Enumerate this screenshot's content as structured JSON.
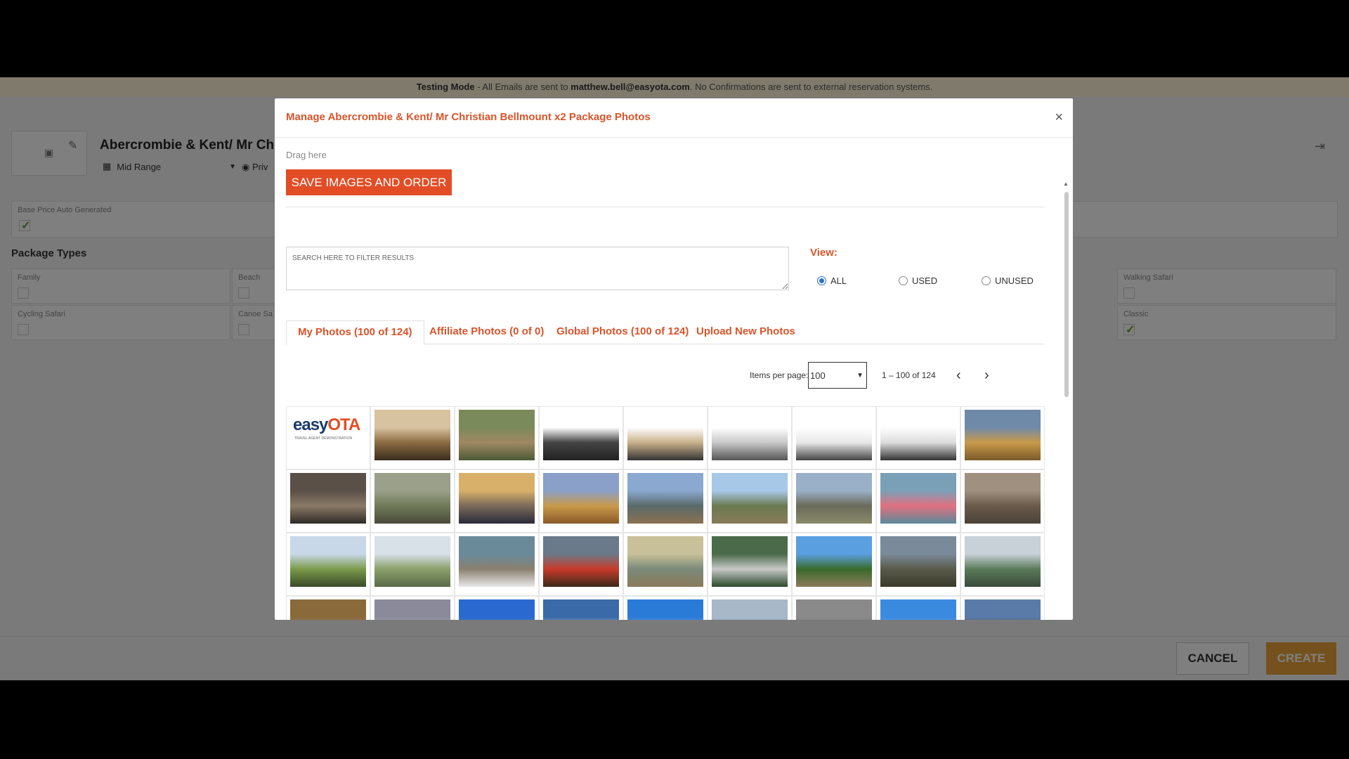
{
  "app": {
    "testing_bar": {
      "mode_label": "Testing Mode",
      "text_before_email": " - All Emails are sent to ",
      "email": "matthew.bell@easyota.com",
      "text_after_email": ". No Confirmations are sent to external reservation systems."
    },
    "package": {
      "title": "Abercrombie & Kent/ Mr Chr",
      "range_value": "Mid Range",
      "privacy_label": "Priv"
    },
    "base_price_label": "Base Price Auto Generated",
    "package_types_title": "Package Types",
    "package_types": [
      {
        "label": "Family",
        "checked": false
      },
      {
        "label": "Beach",
        "checked": false
      },
      {
        "label": "Walking Safari",
        "checked": false
      },
      {
        "label": "Cycling Safari",
        "checked": false
      },
      {
        "label": "Canoe Sa",
        "checked": false
      },
      {
        "label": "Classic",
        "checked": true
      }
    ],
    "footer": {
      "cancel_label": "CANCEL",
      "create_label": "CREATE"
    }
  },
  "modal": {
    "title": "Manage Abercrombie & Kent/ Mr Christian Bellmount x2 Package Photos",
    "close_glyph": "×",
    "drag_here": "Drag here",
    "save_label": "SAVE IMAGES AND ORDER",
    "search_placeholder": "SEARCH HERE TO FILTER RESULTS",
    "view_label": "View:",
    "view_options": [
      {
        "label": "ALL",
        "selected": true
      },
      {
        "label": "USED",
        "selected": false
      },
      {
        "label": "UNUSED",
        "selected": false
      }
    ],
    "tabs": [
      {
        "label": "My Photos (100 of 124)",
        "active": true
      },
      {
        "label": "Affiliate Photos (0 of 0)",
        "active": false
      },
      {
        "label": "Global Photos (100 of 124)",
        "active": false
      },
      {
        "label": "Upload New Photos",
        "active": false
      }
    ],
    "pager": {
      "items_per_page_label": "Items per page:",
      "items_per_page_value": "100",
      "range_label": "1 – 100 of 124"
    },
    "logo": {
      "main": "easy",
      "accent": "OTA",
      "sub": "TRAVEL AGENT DEMONSTRATION"
    },
    "photos": [
      {
        "name": "easyota-logo-photo",
        "kind": "logo"
      },
      {
        "name": "lodge-interior-photo",
        "colors": [
          "#d8c3a0",
          "#8a6a42",
          "#3b2d1e"
        ]
      },
      {
        "name": "giraffes-photo",
        "colors": [
          "#7a8a5a",
          "#a08863",
          "#4a5a36"
        ]
      },
      {
        "name": "safari-jeep-photo",
        "colors": [
          "#ffffff",
          "#444444",
          "#222222"
        ]
      },
      {
        "name": "safari-landcruiser-photo",
        "colors": [
          "#ffffff",
          "#c8b08a",
          "#333333"
        ]
      },
      {
        "name": "silver-van-photo",
        "colors": [
          "#ffffff",
          "#c8c8c8",
          "#555555"
        ]
      },
      {
        "name": "white-minibus-photo",
        "colors": [
          "#ffffff",
          "#e8e8e8",
          "#444444"
        ]
      },
      {
        "name": "white-bus-photo",
        "colors": [
          "#ffffff",
          "#dcdcdc",
          "#333333"
        ]
      },
      {
        "name": "savanna-sunset-photo",
        "colors": [
          "#6f8aa8",
          "#c99a4a",
          "#7a5a2a"
        ]
      },
      {
        "name": "jeep-dust-photo",
        "colors": [
          "#5a5048",
          "#8a7a66",
          "#2e2a26"
        ]
      },
      {
        "name": "jeep-zebras-photo",
        "colors": [
          "#9aa08a",
          "#6f7a58",
          "#4a4a3a"
        ]
      },
      {
        "name": "city-skyline-photo",
        "colors": [
          "#d8b06a",
          "#7a6a5a",
          "#2a2a3a"
        ]
      },
      {
        "name": "zebras-plains-photo",
        "colors": [
          "#8aa0c8",
          "#c89a4a",
          "#8a5a2a"
        ]
      },
      {
        "name": "crater-view-photo",
        "colors": [
          "#8aa8d0",
          "#5a6a6a",
          "#8a7050"
        ]
      },
      {
        "name": "leopard-tree-photo",
        "colors": [
          "#a8c8e8",
          "#6a7a50",
          "#8a7a5a"
        ]
      },
      {
        "name": "wildebeest-photo",
        "colors": [
          "#9ab0c8",
          "#6a6a5a",
          "#8a8a6a"
        ]
      },
      {
        "name": "flamingos-photo",
        "colors": [
          "#7aa0b8",
          "#e07080",
          "#5a8a9a"
        ]
      },
      {
        "name": "elephants-baobab-photo",
        "colors": [
          "#a09080",
          "#6a5a4a",
          "#4a4238"
        ]
      },
      {
        "name": "zebra-grass-photo",
        "colors": [
          "#c8d8e8",
          "#7a9a4a",
          "#3a4a2a"
        ]
      },
      {
        "name": "acacia-tree-photo",
        "colors": [
          "#d8e0e8",
          "#8aa06a",
          "#5a6a4a"
        ]
      },
      {
        "name": "rhino-birds-photo",
        "colors": [
          "#6a8a9a",
          "#8a8070",
          "#e8e8e8"
        ]
      },
      {
        "name": "maasai-warriors-photo",
        "colors": [
          "#6a7a8a",
          "#c83a2a",
          "#3a2a1a"
        ]
      },
      {
        "name": "waterhole-animals-photo",
        "colors": [
          "#c8c098",
          "#7a8a7a",
          "#8a7a5a"
        ]
      },
      {
        "name": "hotel-aerial-photo",
        "colors": [
          "#4a6a4a",
          "#c8c8c8",
          "#2a4a2a"
        ]
      },
      {
        "name": "elephant-acacia-photo",
        "colors": [
          "#5aa0e0",
          "#3a6a2a",
          "#8a7a5a"
        ]
      },
      {
        "name": "baobab-road-photo",
        "colors": [
          "#7a8a9a",
          "#5a5a4a",
          "#3a3a2a"
        ]
      },
      {
        "name": "coastline-aerial-photo",
        "colors": [
          "#c8d0d8",
          "#5a7a5a",
          "#3a4a3a"
        ]
      },
      {
        "name": "lion-closeup-photo",
        "colors": [
          "#8a6a3a",
          "#b08a5a",
          "#5a3a1a"
        ]
      },
      {
        "name": "misty-hills-photo",
        "colors": [
          "#8a8a9a",
          "#c8c8d0",
          "#6a6a7a"
        ]
      },
      {
        "name": "blue-sky-trees-photo",
        "colors": [
          "#2a6ad0",
          "#5a9ae0",
          "#4a7a3a"
        ]
      },
      {
        "name": "snow-mountain-photo",
        "colors": [
          "#3a6aa8",
          "#d8e0e8",
          "#5a7a9a"
        ]
      },
      {
        "name": "ocean-sky-photo",
        "colors": [
          "#2a7ad8",
          "#8ac0e8",
          "#3a8ac8"
        ]
      },
      {
        "name": "cloudy-sky-photo",
        "colors": [
          "#a8b8c8",
          "#6a8aa8",
          "#4a6a8a"
        ]
      },
      {
        "name": "grey-mountains-photo",
        "colors": [
          "#8a8a8a",
          "#6a6a6a",
          "#9a9a9a"
        ]
      },
      {
        "name": "blue-horizon-photo",
        "colors": [
          "#3a8ae0",
          "#7ab0e8",
          "#5a9ad8"
        ]
      },
      {
        "name": "forest-sky-photo",
        "colors": [
          "#5a7aa8",
          "#3a4a3a",
          "#c8d0d8"
        ]
      }
    ]
  }
}
